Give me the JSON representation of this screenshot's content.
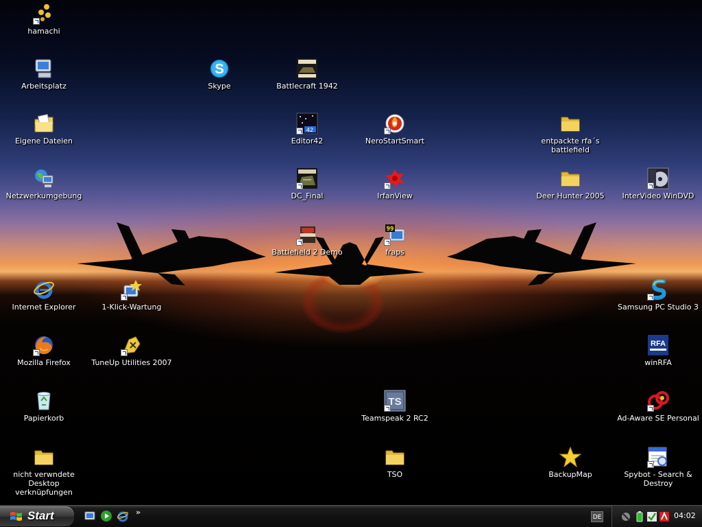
{
  "desktop": {
    "icons": [
      {
        "label": "hamachi",
        "icon": "hamachi-icon",
        "shortcut": true
      },
      {
        "label": "Arbeitsplatz",
        "icon": "my-computer-icon",
        "shortcut": false
      },
      {
        "label": "Eigene Dateien",
        "icon": "my-documents-icon",
        "shortcut": false
      },
      {
        "label": "Netzwerkumgebung",
        "icon": "network-places-icon",
        "shortcut": false
      },
      {
        "label": "Internet Explorer",
        "icon": "internet-explorer-icon",
        "shortcut": false
      },
      {
        "label": "Mozilla Firefox",
        "icon": "firefox-icon",
        "shortcut": true
      },
      {
        "label": "Papierkorb",
        "icon": "recycle-bin-icon",
        "shortcut": false
      },
      {
        "label": "nicht verwndete Desktop\nverknüpfungen",
        "icon": "folder-icon",
        "shortcut": false
      },
      {
        "label": "1-Klick-Wartung",
        "icon": "tuneup-maintenance-icon",
        "shortcut": true
      },
      {
        "label": "TuneUp Utilities 2007",
        "icon": "tuneup-utilities-icon",
        "shortcut": true
      },
      {
        "label": "Skype",
        "icon": "skype-icon",
        "shortcut": false
      },
      {
        "label": "Battlecraft 1942",
        "icon": "battlecraft-icon",
        "shortcut": false
      },
      {
        "label": "Editor42",
        "icon": "editor42-icon",
        "shortcut": true
      },
      {
        "label": "DC_Final",
        "icon": "battlefield-dc-icon",
        "shortcut": true
      },
      {
        "label": "Battlefield 2 Demo",
        "icon": "battlefield2-icon",
        "shortcut": true
      },
      {
        "label": "NeroStartSmart",
        "icon": "nero-icon",
        "shortcut": true
      },
      {
        "label": "IrfanView",
        "icon": "irfanview-icon",
        "shortcut": true
      },
      {
        "label": "fraps",
        "icon": "fraps-icon",
        "shortcut": true
      },
      {
        "label": "Teamspeak 2 RC2",
        "icon": "teamspeak-icon",
        "shortcut": true
      },
      {
        "label": "TSO",
        "icon": "folder-icon",
        "shortcut": false
      },
      {
        "label": "entpackte rfa´s\nbattlefield",
        "icon": "folder-icon",
        "shortcut": false
      },
      {
        "label": "Deer Hunter 2005",
        "icon": "folder-icon",
        "shortcut": false
      },
      {
        "label": "BackupMap",
        "icon": "star-icon",
        "shortcut": false
      },
      {
        "label": "InterVideo WinDVD",
        "icon": "windvd-icon",
        "shortcut": true
      },
      {
        "label": "Samsung PC Studio 3",
        "icon": "samsung-pc-studio-icon",
        "shortcut": true
      },
      {
        "label": "winRFA",
        "icon": "winrfa-icon",
        "shortcut": false
      },
      {
        "label": "Ad-Aware SE Personal",
        "icon": "ad-aware-icon",
        "shortcut": true
      },
      {
        "label": "Spybot - Search &\nDestroy",
        "icon": "spybot-icon",
        "shortcut": true
      }
    ]
  },
  "taskbar": {
    "start_label": "Start",
    "quick_launch": [
      "show-desktop-icon",
      "media-player-icon",
      "internet-explorer-icon"
    ],
    "chevron": "»",
    "language": "DE",
    "tray_icons": [
      "network-status-icon",
      "battery-icon",
      "security-check-icon",
      "antivirus-icon"
    ],
    "clock": "04:02"
  },
  "colors": {
    "folder": "#f3d35e",
    "taskbar": "#151515",
    "start_button": "#3d3d3d"
  }
}
